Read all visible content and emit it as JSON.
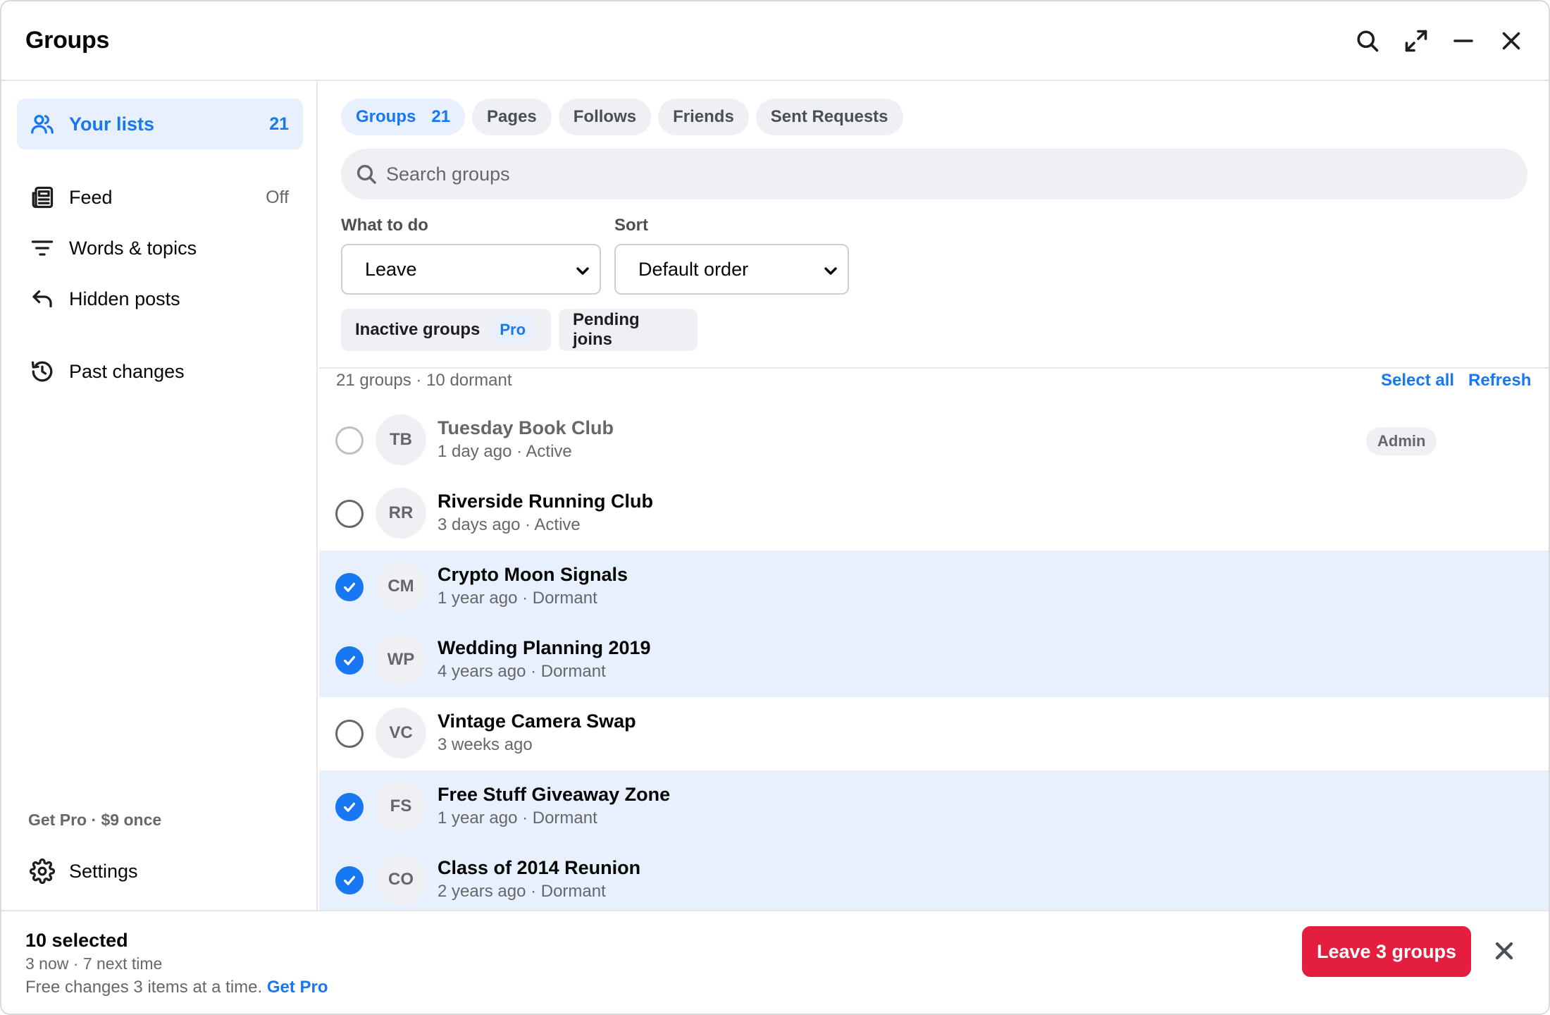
{
  "window": {
    "title": "Groups"
  },
  "header_icons": [
    "search-icon",
    "expand-icon",
    "minimize-icon",
    "close-icon"
  ],
  "sidebar": {
    "items": [
      {
        "label": "Your lists",
        "count": "21",
        "icon": "people-icon",
        "active": true
      },
      {
        "label": "Feed",
        "count": "Off",
        "icon": "newspaper-icon"
      },
      {
        "label": "Words & topics",
        "icon": "filter-icon"
      },
      {
        "label": "Hidden posts",
        "icon": "undo-icon"
      },
      {
        "label": "Past changes",
        "icon": "history-icon"
      }
    ],
    "get_pro": "Get Pro · $9 once",
    "settings": {
      "label": "Settings",
      "icon": "gear-icon"
    }
  },
  "tabs": [
    {
      "label": "Groups",
      "count": "21",
      "active": true
    },
    {
      "label": "Pages"
    },
    {
      "label": "Follows"
    },
    {
      "label": "Friends"
    },
    {
      "label": "Sent Requests"
    }
  ],
  "search": {
    "placeholder": "Search groups",
    "value": ""
  },
  "filters": {
    "what_to_do": {
      "label": "What to do",
      "value": "Leave"
    },
    "sort": {
      "label": "Sort",
      "value": "Default order"
    }
  },
  "chips": [
    {
      "label": "Inactive groups",
      "badge": "Pro"
    },
    {
      "label": "Pending joins"
    }
  ],
  "list": {
    "summary": "21 groups · 10 dormant",
    "select_all": "Select all",
    "refresh": "Refresh",
    "groups": [
      {
        "initials": "TB",
        "name": "Tuesday Book Club",
        "meta": "1 day ago · Active",
        "selected": false,
        "badge": "Admin",
        "disabled": true
      },
      {
        "initials": "RR",
        "name": "Riverside Running Club",
        "meta": "3 days ago · Active",
        "selected": false
      },
      {
        "initials": "CM",
        "name": "Crypto Moon Signals",
        "meta": "1 year ago · Dormant",
        "selected": true
      },
      {
        "initials": "WP",
        "name": "Wedding Planning 2019",
        "meta": "4 years ago · Dormant",
        "selected": true
      },
      {
        "initials": "VC",
        "name": "Vintage Camera Swap",
        "meta": "3 weeks ago",
        "selected": false
      },
      {
        "initials": "FS",
        "name": "Free Stuff Giveaway Zone",
        "meta": "1 year ago · Dormant",
        "selected": true
      },
      {
        "initials": "CO",
        "name": "Class of 2014 Reunion",
        "meta": "2 years ago · Dormant",
        "selected": true
      }
    ]
  },
  "footer": {
    "selected": "10 selected",
    "breakdown": "3 now · 7 next time",
    "note": "Free changes 3 items at a time.",
    "note_link": "Get Pro",
    "action": "Leave 3 groups"
  },
  "colors": {
    "accent": "#1877f2",
    "selected_row": "#e7f0fc",
    "danger": "#e41e3f",
    "muted_text": "#65676b"
  }
}
